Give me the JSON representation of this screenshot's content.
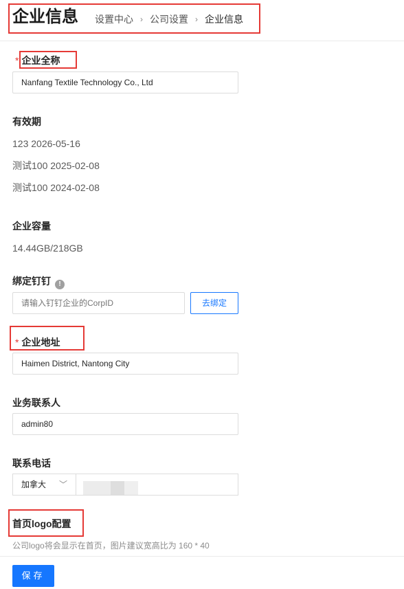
{
  "header": {
    "title": "企业信息",
    "breadcrumb": [
      "设置中心",
      "公司设置",
      "企业信息"
    ]
  },
  "company_name": {
    "label": "企业全称",
    "required_mark": "*",
    "value": "Nanfang Textile Technology Co., Ltd"
  },
  "validity": {
    "label": "有效期",
    "items": [
      "123 2026-05-16",
      "测试100 2025-02-08",
      "测试100 2024-02-08"
    ]
  },
  "capacity": {
    "label": "企业容量",
    "value": "14.44GB/218GB"
  },
  "dingtalk": {
    "label": "绑定钉钉",
    "info_icon": "info-icon",
    "placeholder": "请输入钉钉企业的CorpID",
    "unbind_label": "去绑定"
  },
  "address": {
    "label": "企业地址",
    "required_mark": "*",
    "value": "Haimen District, Nantong City"
  },
  "contact": {
    "label": "业务联系人",
    "value": "admin80"
  },
  "phone": {
    "label": "联系电话",
    "country": "加拿大",
    "country_icon": "chevron-down-icon"
  },
  "logo": {
    "label": "首页logo配置",
    "hint": "公司logo将会显示在首页，图片建议宽高比为 160 * 40"
  },
  "footer": {
    "save_label": "保存"
  },
  "colors": {
    "primary": "#1677ff",
    "required": "#e53935",
    "highlight_box": "#e53935"
  }
}
